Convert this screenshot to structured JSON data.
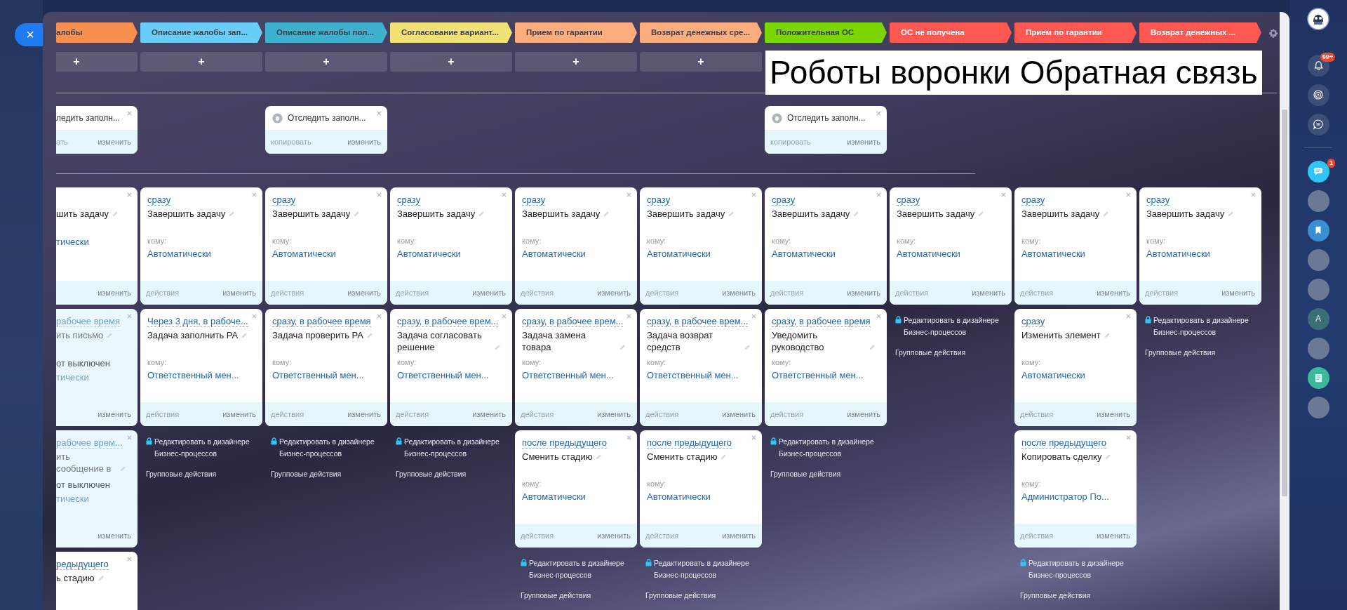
{
  "close_button": "×",
  "overlay_title": "Роботы воронки Обратная связь",
  "columns": [
    {
      "clipped": true,
      "stage": {
        "label": "алобы",
        "color": "#f7904f"
      },
      "add": "+",
      "trigger": {
        "title": "ледить заполн...",
        "copy": "ать",
        "edit": "изменить"
      },
      "robots": [
        {
          "disabled": false,
          "title": "шить задачу",
          "assignee": "тически",
          "edit": "изменить"
        },
        {
          "disabled": true,
          "delay": "рабочее время",
          "title": "ить письмо",
          "note": "от выключен",
          "assignee": "тически",
          "edit": "изменить"
        },
        {
          "disabled": true,
          "delay": "рабочее врем...",
          "title": "ить сообщение в",
          "note": "от выключен",
          "assignee": "тически",
          "edit": "изменить"
        },
        {
          "disabled": false,
          "delay": "редыдущего",
          "title": "ь стадию"
        }
      ]
    },
    {
      "clipped": false,
      "stage": {
        "label": "Описание жалобы зап...",
        "color": "#6acdf8"
      },
      "add": "+",
      "robots": [
        {
          "disabled": false,
          "delay": "сразу",
          "title": "Завершить задачу",
          "to_label": "кому:",
          "assignee": "Автоматически",
          "actions": "действия",
          "edit": "изменить"
        },
        {
          "disabled": false,
          "delay": "Через 3 дня, в рабоче...",
          "title": "Задача заполнить РА",
          "to_label": "кому:",
          "assignee": "Ответственный мен...",
          "actions": "действия",
          "edit": "изменить"
        }
      ],
      "footer": {
        "designer_link": "Редактировать в дизайнере Бизнес-процессов",
        "group_actions": "Групповые действия"
      }
    },
    {
      "clipped": false,
      "stage": {
        "label": "Описание жалобы пол...",
        "color": "#3db1cd"
      },
      "add": "+",
      "trigger": {
        "title": "Отследить заполн...",
        "copy": "копировать",
        "edit": "изменить"
      },
      "robots": [
        {
          "disabled": false,
          "delay": "сразу",
          "title": "Завершить задачу",
          "to_label": "кому:",
          "assignee": "Автоматически",
          "actions": "действия",
          "edit": "изменить"
        },
        {
          "disabled": false,
          "delay": "сразу, в рабочее время",
          "title": "Задача проверить РА",
          "to_label": "кому:",
          "assignee": "Ответственный мен...",
          "actions": "действия",
          "edit": "изменить"
        }
      ],
      "footer": {
        "designer_link": "Редактировать в дизайнере Бизнес-процессов",
        "group_actions": "Групповые действия"
      }
    },
    {
      "clipped": false,
      "stage": {
        "label": "Согласование вариант...",
        "color": "#f2e276"
      },
      "add": "+",
      "robots": [
        {
          "disabled": false,
          "delay": "сразу",
          "title": "Завершить задачу",
          "to_label": "кому:",
          "assignee": "Автоматически",
          "actions": "действия",
          "edit": "изменить"
        },
        {
          "disabled": false,
          "delay": "сразу, в рабочее врем...",
          "title": "Задача согласовать решение",
          "to_label": "кому:",
          "assignee": "Ответственный мен...",
          "actions": "действия",
          "edit": "изменить"
        }
      ],
      "footer": {
        "designer_link": "Редактировать в дизайнере Бизнес-процессов",
        "group_actions": "Групповые действия"
      }
    },
    {
      "clipped": false,
      "stage": {
        "label": "Прием по гарантии",
        "color": "#fdad7d"
      },
      "add": "+",
      "robots": [
        {
          "disabled": false,
          "delay": "сразу",
          "title": "Завершить задачу",
          "to_label": "кому:",
          "assignee": "Автоматически",
          "actions": "действия",
          "edit": "изменить"
        },
        {
          "disabled": false,
          "delay": "сразу, в рабочее врем...",
          "title": "Задача замена товара",
          "to_label": "кому:",
          "assignee": "Ответственный мен...",
          "actions": "действия",
          "edit": "изменить"
        },
        {
          "disabled": false,
          "delay": "после предыдущего",
          "title": "Сменить стадию",
          "to_label": "кому:",
          "assignee": "Автоматически",
          "actions": "действия",
          "edit": "изменить"
        }
      ],
      "footer": {
        "designer_link": "Редактировать в дизайнере Бизнес-процессов",
        "group_actions": "Групповые действия"
      }
    },
    {
      "clipped": false,
      "stage": {
        "label": "Возврат денежных сре...",
        "color": "#fdad7d"
      },
      "add": "+",
      "robots": [
        {
          "disabled": false,
          "delay": "сразу",
          "title": "Завершить задачу",
          "to_label": "кому:",
          "assignee": "Автоматически",
          "actions": "действия",
          "edit": "изменить"
        },
        {
          "disabled": false,
          "delay": "сразу, в рабочее врем...",
          "title": "Задача возврат средств",
          "to_label": "кому:",
          "assignee": "Ответственный мен...",
          "actions": "действия",
          "edit": "изменить"
        },
        {
          "disabled": false,
          "delay": "после предыдущего",
          "title": "Сменить стадию",
          "to_label": "кому:",
          "assignee": "Автоматически",
          "actions": "действия",
          "edit": "изменить"
        }
      ],
      "footer": {
        "designer_link": "Редактировать в дизайнере Бизнес-процессов",
        "group_actions": "Групповые действия"
      }
    },
    {
      "clipped": false,
      "stage": {
        "label": "Положительная ОС",
        "color": "#7bd500"
      },
      "trigger": {
        "title": "Отследить заполн...",
        "copy": "копировать",
        "edit": "изменить"
      },
      "robots": [
        {
          "disabled": false,
          "delay": "сразу",
          "title": "Завершить задачу",
          "to_label": "кому:",
          "assignee": "Автоматически",
          "actions": "действия",
          "edit": "изменить"
        },
        {
          "disabled": false,
          "delay": "сразу, в рабочее время",
          "title": "Уведомить руководство",
          "to_label": "кому:",
          "assignee": "Ответственный мен...",
          "actions": "действия",
          "edit": "изменить"
        }
      ],
      "footer": {
        "designer_link": "Редактировать в дизайнере Бизнес-процессов",
        "group_actions": "Групповые действия"
      }
    },
    {
      "clipped": false,
      "stage": {
        "label": "ОС не получена",
        "color": "#ff5752"
      },
      "robots": [
        {
          "disabled": false,
          "delay": "сразу",
          "title": "Завершить задачу",
          "to_label": "кому:",
          "assignee": "Автоматически",
          "actions": "действия",
          "edit": "изменить"
        }
      ],
      "footer": {
        "designer_link": "Редактировать в дизайнере Бизнес-процессов",
        "group_actions": "Групповые действия"
      }
    },
    {
      "clipped": false,
      "stage": {
        "label": "Прием по гарантии",
        "color": "#ff5752"
      },
      "robots": [
        {
          "disabled": false,
          "delay": "сразу",
          "title": "Завершить задачу",
          "to_label": "кому:",
          "assignee": "Автоматически",
          "actions": "действия",
          "edit": "изменить"
        },
        {
          "disabled": false,
          "delay": "сразу",
          "title": "Изменить элемент",
          "to_label": "кому:",
          "assignee": "Автоматически",
          "actions": "действия",
          "edit": "изменить"
        },
        {
          "disabled": false,
          "delay": "после предыдущего",
          "title": "Копировать сделку",
          "to_label": "кому:",
          "assignee": "Администратор По...",
          "actions": "действия",
          "edit": "изменить"
        }
      ],
      "footer": {
        "designer_link": "Редактировать в дизайнере Бизнес-процессов",
        "group_actions": "Групповые действия"
      }
    },
    {
      "clipped": false,
      "stage": {
        "label": "Возврат денежных ...",
        "color": "#ff5752"
      },
      "robots": [
        {
          "disabled": false,
          "delay": "сразу",
          "title": "Завершить задачу",
          "to_label": "кому:",
          "assignee": "Автоматически",
          "actions": "действия",
          "edit": "изменить"
        }
      ],
      "footer": {
        "designer_link": "Редактировать в дизайнере Бизнес-процессов",
        "group_actions": "Групповые действия"
      }
    }
  ],
  "right_sidebar": [
    {
      "kind": "avatar"
    },
    {
      "kind": "bell",
      "badge": "99+"
    },
    {
      "kind": "swirl"
    },
    {
      "kind": "chat"
    },
    {
      "kind": "divider"
    },
    {
      "kind": "messages",
      "badge": "1"
    },
    {
      "kind": "photo"
    },
    {
      "kind": "bookmark"
    },
    {
      "kind": "photo"
    },
    {
      "kind": "photo"
    },
    {
      "kind": "letter",
      "letter": "A"
    },
    {
      "kind": "photo"
    },
    {
      "kind": "document"
    },
    {
      "kind": "photo"
    }
  ]
}
